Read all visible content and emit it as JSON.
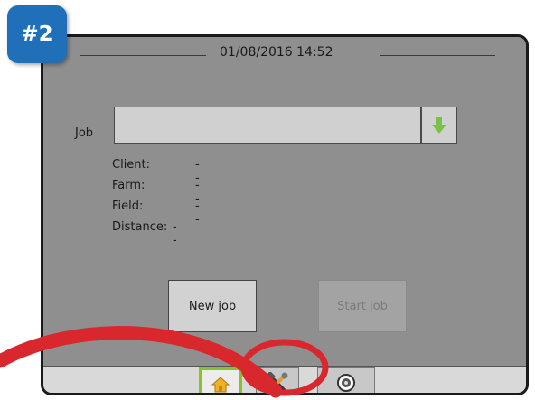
{
  "badge": {
    "text": "#2"
  },
  "header": {
    "datetime": "01/08/2016 14:52"
  },
  "job": {
    "label": "Job",
    "value": "",
    "dropdown_icon": "down-arrow-icon"
  },
  "details": [
    {
      "label": "Client:",
      "value": "--"
    },
    {
      "label": "Farm:",
      "value": "--"
    },
    {
      "label": "Field:",
      "value": "--"
    },
    {
      "label": "Distance:",
      "value": "--"
    }
  ],
  "buttons": {
    "new_job": "New job",
    "start_job": "Start job"
  },
  "tabs": [
    {
      "name": "home",
      "icon": "home-icon",
      "active": true
    },
    {
      "name": "tools",
      "icon": "tools-icon",
      "active": false
    },
    {
      "name": "camera",
      "icon": "camera-icon",
      "active": false
    }
  ],
  "colors": {
    "screen_bg": "#8f8f8f",
    "badge_bg": "#1f70b8",
    "annotation": "#d9272e",
    "accent_green": "#8bbf2b"
  }
}
